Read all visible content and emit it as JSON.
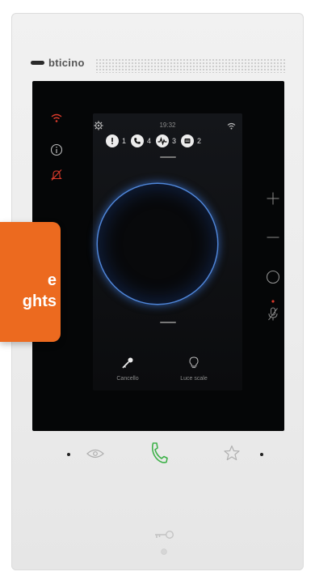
{
  "brand": {
    "name": "bticino"
  },
  "status": {
    "time": "19:32"
  },
  "notifications": [
    {
      "icon": "alert-icon",
      "count": "1"
    },
    {
      "icon": "missed-call-icon",
      "count": "4"
    },
    {
      "icon": "activity-icon",
      "count": "3"
    },
    {
      "icon": "message-icon",
      "count": "2"
    }
  ],
  "shortcuts": [
    {
      "label": "Cancello",
      "icon": "gate-key-icon"
    },
    {
      "label": "Luce scale",
      "icon": "bulb-icon"
    }
  ],
  "promo": {
    "line1": "e",
    "line2": "ghts"
  },
  "colors": {
    "accent_red": "#d93a2b",
    "call_green": "#3fb24a",
    "ring_blue": "#4f86d8",
    "promo_orange": "#ec6a1f"
  }
}
